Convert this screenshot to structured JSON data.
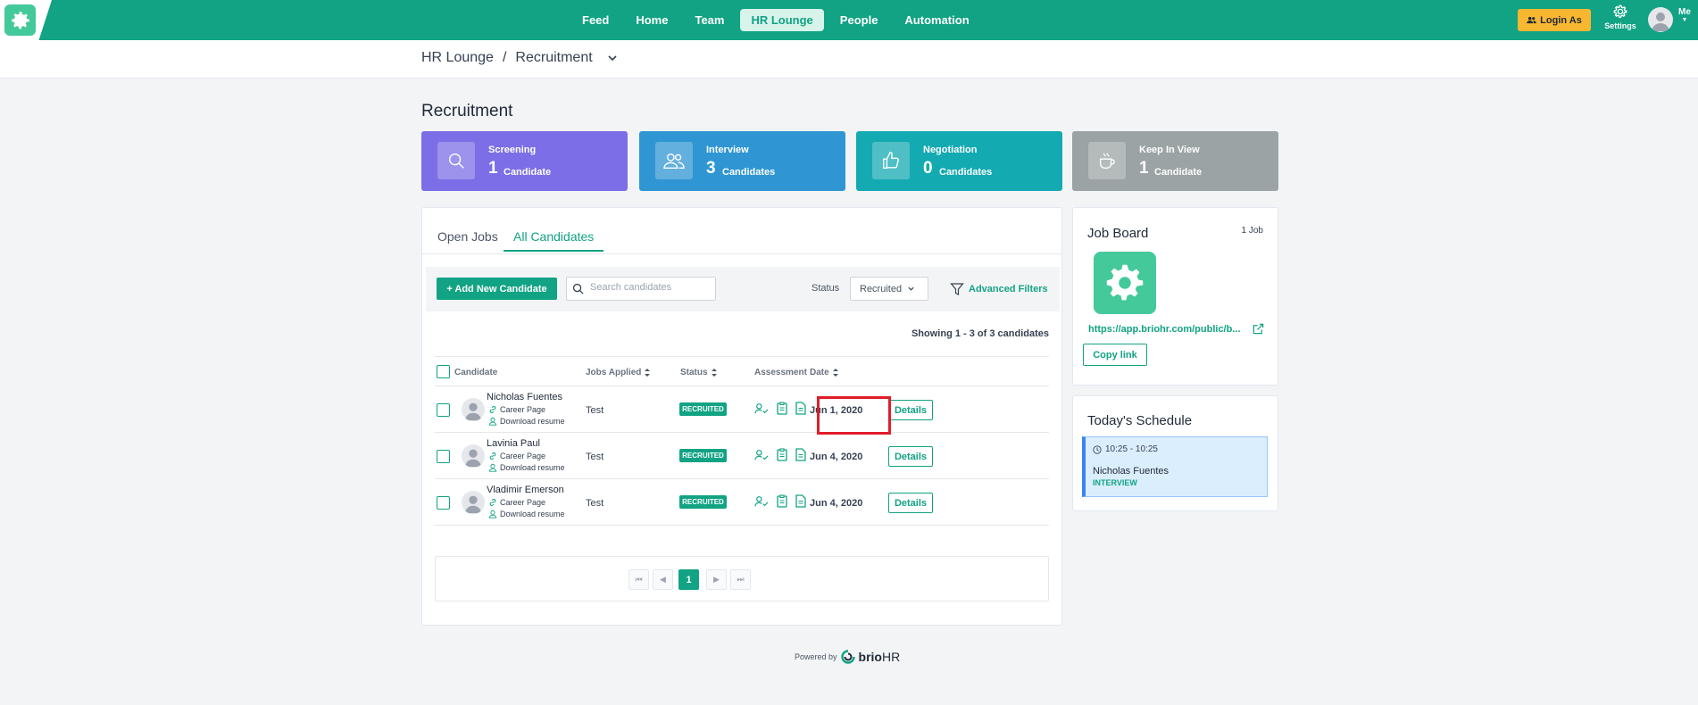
{
  "colors": {
    "brand": "#11a383",
    "screening": "#7c6ee6",
    "interview": "#2f96d3",
    "negotiation": "#14aab2",
    "keep_in_view": "#9ca3a4",
    "highlight": "#e11d2a"
  },
  "nav": {
    "items": [
      "Feed",
      "Home",
      "Team",
      "HR Lounge",
      "People",
      "Automation"
    ],
    "active": "HR Lounge",
    "login_as": "Login As",
    "settings": "Settings",
    "me": "Me"
  },
  "breadcrumb": {
    "parent": "HR Lounge",
    "separator": "/",
    "current": "Recruitment"
  },
  "page_title": "Recruitment",
  "stats": [
    {
      "label": "Screening",
      "count": "1",
      "unit": "Candidate",
      "icon": "search-icon"
    },
    {
      "label": "Interview",
      "count": "3",
      "unit": "Candidates",
      "icon": "users-icon"
    },
    {
      "label": "Negotiation",
      "count": "0",
      "unit": "Candidates",
      "icon": "thumbs-up-icon"
    },
    {
      "label": "Keep In View",
      "count": "1",
      "unit": "Candidate",
      "icon": "coffee-icon"
    }
  ],
  "tabs": [
    "Open Jobs",
    "All Candidates"
  ],
  "active_tab": "All Candidates",
  "toolbar": {
    "add_label": "+ Add New Candidate",
    "search_placeholder": "Search candidates",
    "status_label": "Status",
    "status_value": "Recruited",
    "advanced_filters": "Advanced Filters"
  },
  "showing": "Showing 1 - 3 of 3 candidates",
  "table": {
    "headers": {
      "candidate": "Candidate",
      "jobs": "Jobs Applied",
      "status": "Status",
      "assessment": "Assessment",
      "date": "Date"
    },
    "rows": [
      {
        "name": "Nicholas Fuentes",
        "source": "Career Page",
        "resume": "Download resume",
        "job": "Test",
        "status": "RECRUITED",
        "date": "Jun 1, 2020",
        "action": "Details"
      },
      {
        "name": "Lavinia Paul",
        "source": "Career Page",
        "resume": "Download resume",
        "job": "Test",
        "status": "RECRUITED",
        "date": "Jun 4, 2020",
        "action": "Details"
      },
      {
        "name": "Vladimir Emerson",
        "source": "Career Page",
        "resume": "Download resume",
        "job": "Test",
        "status": "RECRUITED",
        "date": "Jun 4, 2020",
        "action": "Details"
      }
    ]
  },
  "pagination": {
    "current": "1"
  },
  "job_board": {
    "title": "Job Board",
    "count": "1 Job",
    "url": "https://app.briohr.com/public/b...",
    "copy_label": "Copy link"
  },
  "schedule": {
    "title": "Today's Schedule",
    "event": {
      "time": "10:25 - 10:25",
      "name": "Nicholas Fuentes",
      "type": "INTERVIEW"
    }
  },
  "footer": {
    "powered_by": "Powered by",
    "brand_a": "brio",
    "brand_b": "HR"
  }
}
